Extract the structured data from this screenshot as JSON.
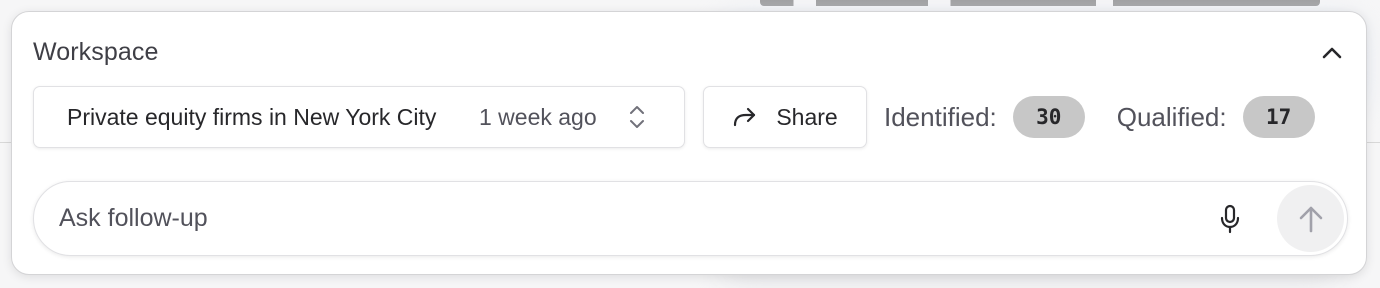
{
  "panel": {
    "title": "Workspace",
    "collapse_icon": "chevron-up-icon"
  },
  "thread": {
    "name": "Private equity firms in New York City",
    "time": "1 week ago",
    "chevron_icon": "chevron-up-down-icon"
  },
  "share": {
    "label": "Share",
    "icon": "share-arrow-icon"
  },
  "stats": {
    "identified_label": "Identified:",
    "identified_count": "30",
    "qualified_label": "Qualified:",
    "qualified_count": "17"
  },
  "ask": {
    "placeholder": "Ask follow-up",
    "mic_icon": "microphone-icon",
    "send_icon": "arrow-up-icon"
  },
  "colors": {
    "panel_bg": "#ffffff",
    "badge_bg": "#c7c7c7",
    "send_bg": "#f0f0f1",
    "text_primary": "#27272a",
    "text_muted": "#52525b"
  }
}
